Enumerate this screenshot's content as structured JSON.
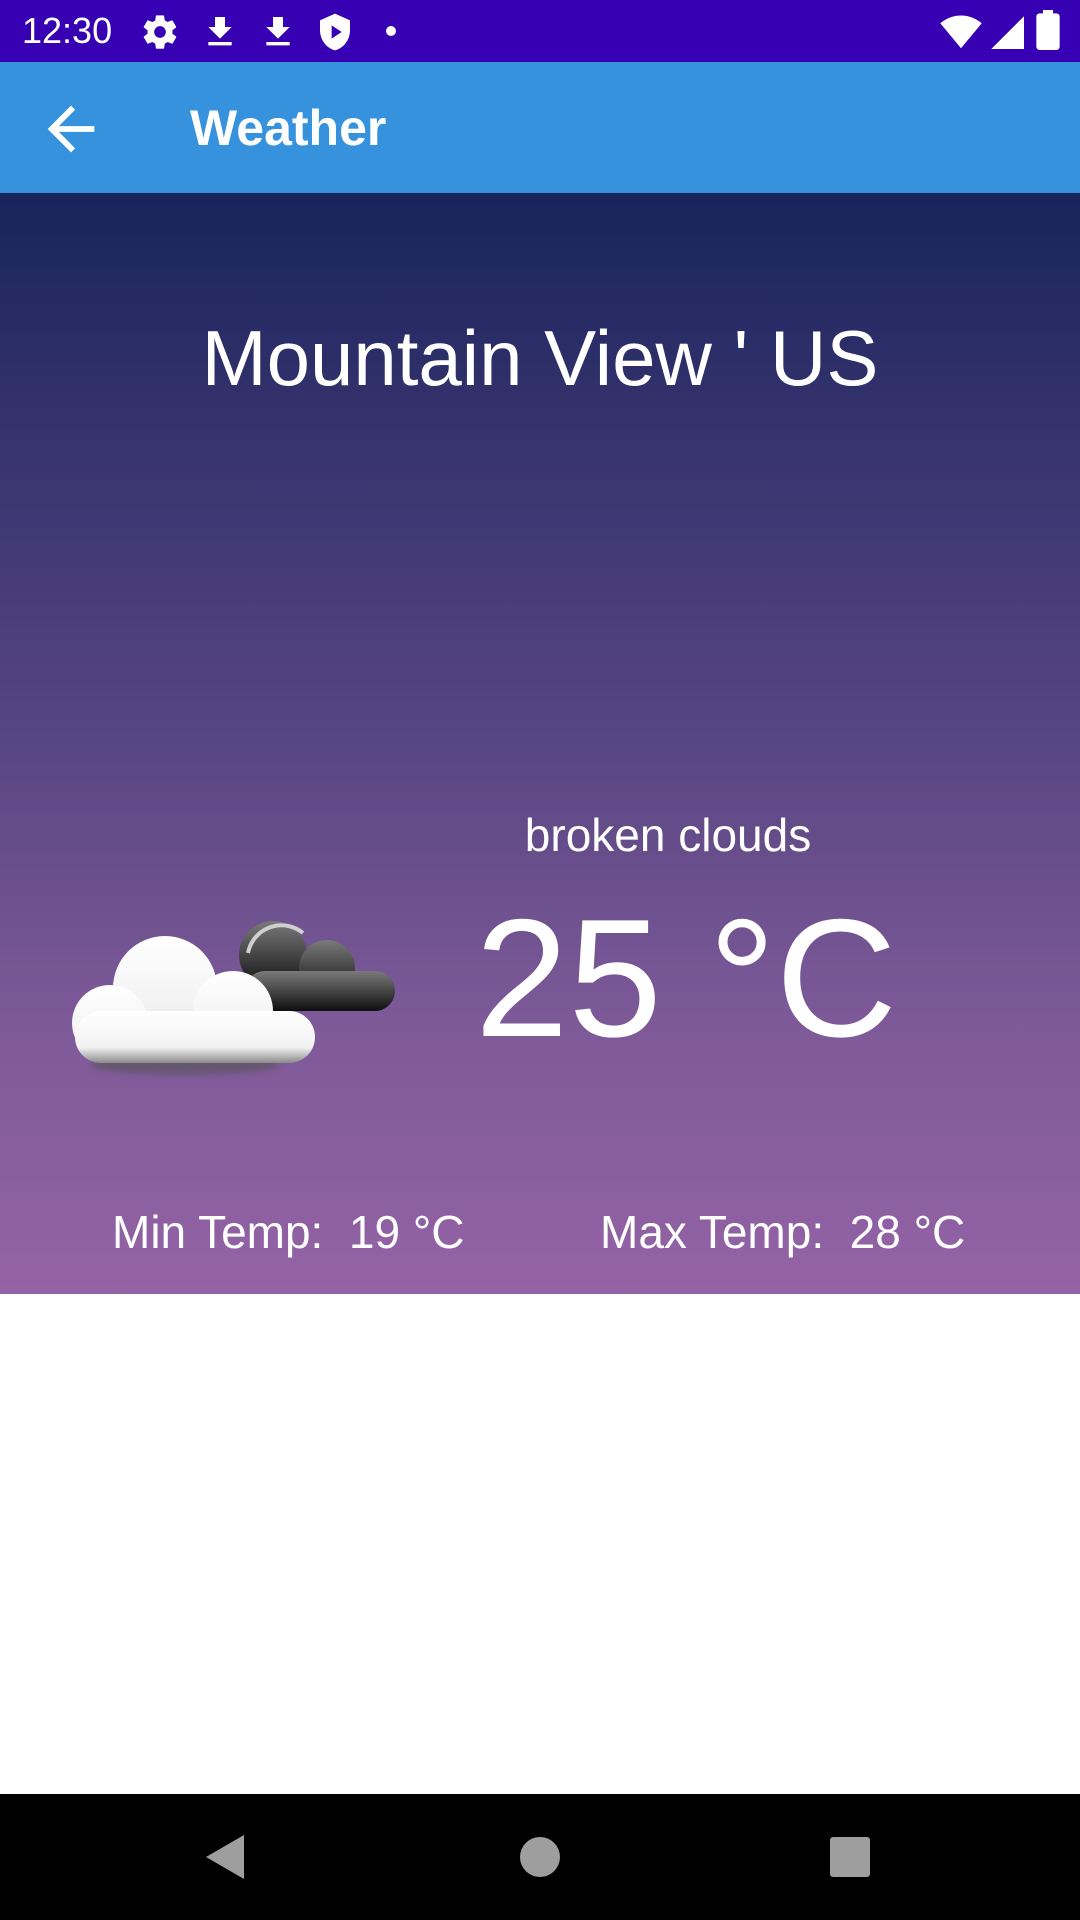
{
  "status_bar": {
    "time": "12:30",
    "icons": [
      "gear-icon",
      "download-icon",
      "download-icon",
      "shield-play-icon",
      "dot-icon",
      "wifi-icon",
      "signal-icon",
      "battery-icon"
    ],
    "background": "#3700b3"
  },
  "app_bar": {
    "title": "Weather",
    "back_icon": "arrow-back-icon",
    "background": "#3792de"
  },
  "weather": {
    "city": "Mountain View ' US",
    "description": "broken clouds",
    "temperature": "25 °C",
    "min_temp": "Min Temp:  19 °C",
    "max_temp": "Max Temp:  28 °C",
    "icon": "broken-clouds-icon",
    "gradient_top": "#18245c",
    "gradient_bottom": "#9463a6"
  },
  "nav_bar": {
    "buttons": [
      "back-triangle-icon",
      "home-circle-icon",
      "recents-square-icon"
    ]
  }
}
